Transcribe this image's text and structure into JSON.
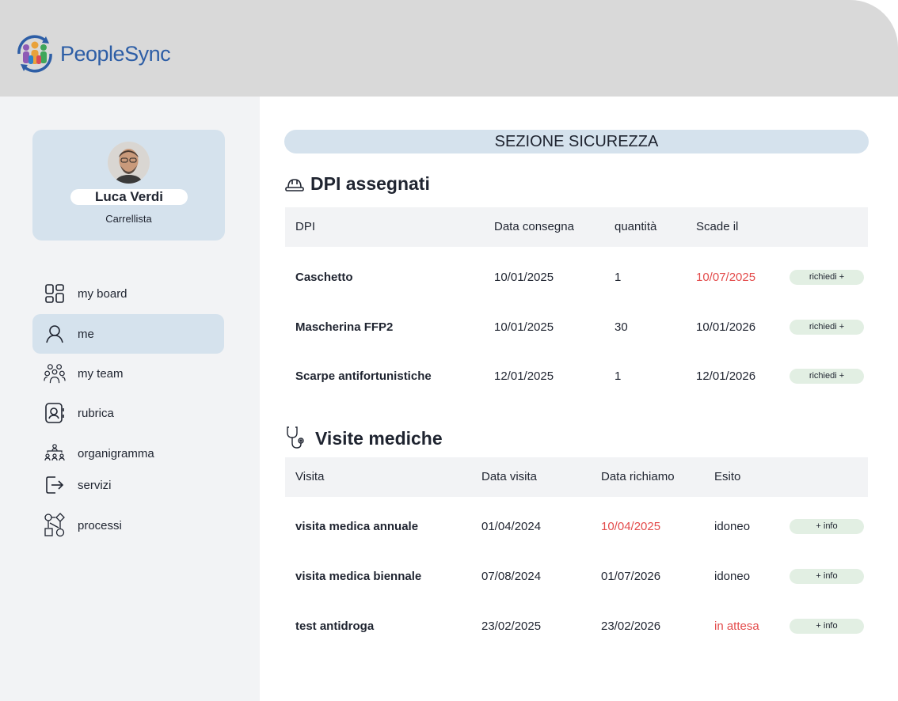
{
  "app": {
    "name": "PeopleSync"
  },
  "profile": {
    "name": "Luca Verdi",
    "role": "Carrellista"
  },
  "nav": [
    {
      "label": "my board",
      "icon": "dashboard-icon"
    },
    {
      "label": "me",
      "icon": "user-icon",
      "active": true
    },
    {
      "label": "my team",
      "icon": "team-icon"
    },
    {
      "label": "rubrica",
      "icon": "contacts-icon"
    },
    {
      "label": "organigramma",
      "icon": "org-chart-icon"
    },
    {
      "label": "servizi",
      "icon": "exit-icon"
    },
    {
      "label": "processi",
      "icon": "process-icon"
    }
  ],
  "section": {
    "title": "SEZIONE SICUREZZA"
  },
  "dpi": {
    "title": "DPI assegnati",
    "headers": [
      "DPI",
      "Data consegna",
      "quantità",
      "Scade il"
    ],
    "rows": [
      {
        "name": "Caschetto",
        "delivered": "10/01/2025",
        "qty": "1",
        "expires": "10/07/2025",
        "expired": true,
        "action": "richiedi +"
      },
      {
        "name": "Mascherina FFP2",
        "delivered": "10/01/2025",
        "qty": "30",
        "expires": "10/01/2026",
        "expired": false,
        "action": "richiedi +"
      },
      {
        "name": "Scarpe antifortunistiche",
        "delivered": "12/01/2025",
        "qty": "1",
        "expires": "12/01/2026",
        "expired": false,
        "action": "richiedi +"
      }
    ]
  },
  "visits": {
    "title": "Visite mediche",
    "headers": [
      "Visita",
      "Data visita",
      "Data richiamo",
      "Esito"
    ],
    "rows": [
      {
        "name": "visita medica annuale",
        "date": "01/04/2024",
        "recall": "10/04/2025",
        "recall_overdue": true,
        "outcome": "idoneo",
        "outcome_pending": false,
        "action": "+ info"
      },
      {
        "name": "visita medica biennale",
        "date": "07/08/2024",
        "recall": "01/07/2026",
        "recall_overdue": false,
        "outcome": "idoneo",
        "outcome_pending": false,
        "action": "+ info"
      },
      {
        "name": "test antidroga",
        "date": "23/02/2025",
        "recall": "23/02/2026",
        "recall_overdue": false,
        "outcome": "in attesa",
        "outcome_pending": true,
        "action": "+ info"
      }
    ]
  },
  "colors": {
    "accent": "#d5e2ed",
    "danger": "#e34b4b",
    "action": "#e2efe3",
    "brand": "#2d5ea6"
  }
}
